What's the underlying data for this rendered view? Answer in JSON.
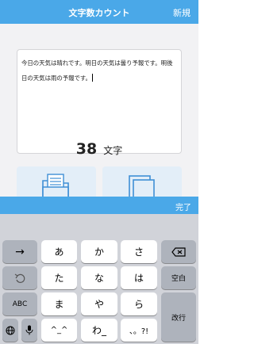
{
  "navbar": {
    "title": "文字数カウント",
    "new_label": "新規"
  },
  "editor": {
    "text": "今日の天気は晴れです。明日の天気は曇り予報です。明後日の天気は雨の予報です。"
  },
  "counter": {
    "number": "38",
    "unit": "文字"
  },
  "accessory": {
    "done_label": "完了"
  },
  "keyboard": {
    "row1": {
      "left": "→",
      "keys": [
        "あ",
        "か",
        "さ"
      ],
      "right": "delete-icon"
    },
    "row2": {
      "left": "undo-icon",
      "keys": [
        "た",
        "な",
        "は"
      ],
      "right": "空白"
    },
    "row3": {
      "left": "ABC",
      "keys": [
        "ま",
        "や",
        "ら"
      ],
      "right": "改行"
    },
    "row4": {
      "left_a": "globe-icon",
      "left_b": "microphone-icon",
      "keys": [
        "^_^",
        "わ_",
        "、。?!"
      ]
    }
  },
  "colors": {
    "navbar": "#4aa8e8",
    "background": "#f2f2f4",
    "keyboard": "#d1d3d9"
  }
}
